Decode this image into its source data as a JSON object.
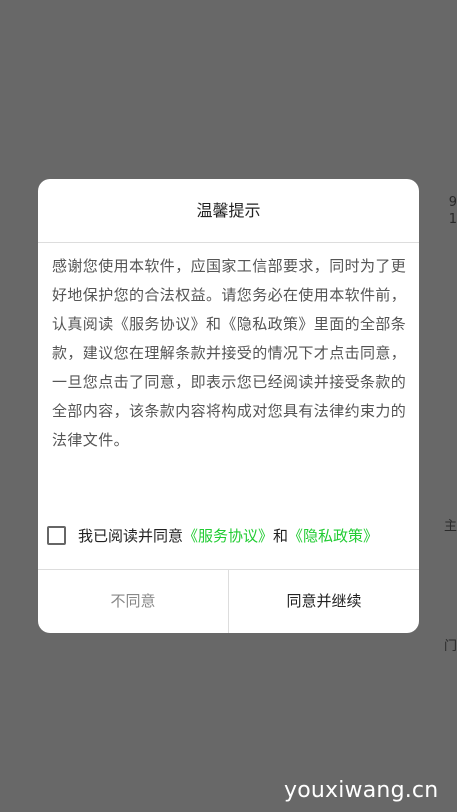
{
  "background_fragments": [
    "9",
    "1",
    "主",
    "门"
  ],
  "dialog": {
    "title": "温馨提示",
    "body": "感谢您使用本软件，应国家工信部要求，同时为了更好地保护您的合法权益。请您务必在使用本软件前，认真阅读《服务协议》和《隐私政策》里面的全部条款，建议您在理解条款并接受的情况下才点击同意，一旦您点击了同意，即表示您已经阅读并接受条款的全部内容，该条款内容将构成对您具有法律约束力的法律文件。",
    "agree_prefix": "我已阅读并同意",
    "service_agreement_link": "《服务协议》",
    "and_text": "和",
    "privacy_policy_link": "《隐私政策》",
    "checkbox_checked": false,
    "disagree_label": "不同意",
    "agree_label": "同意并继续"
  },
  "watermark": "youxiwang.cn",
  "colors": {
    "backdrop": "#686868",
    "link": "#22cc33",
    "dialog_bg": "#ffffff"
  }
}
